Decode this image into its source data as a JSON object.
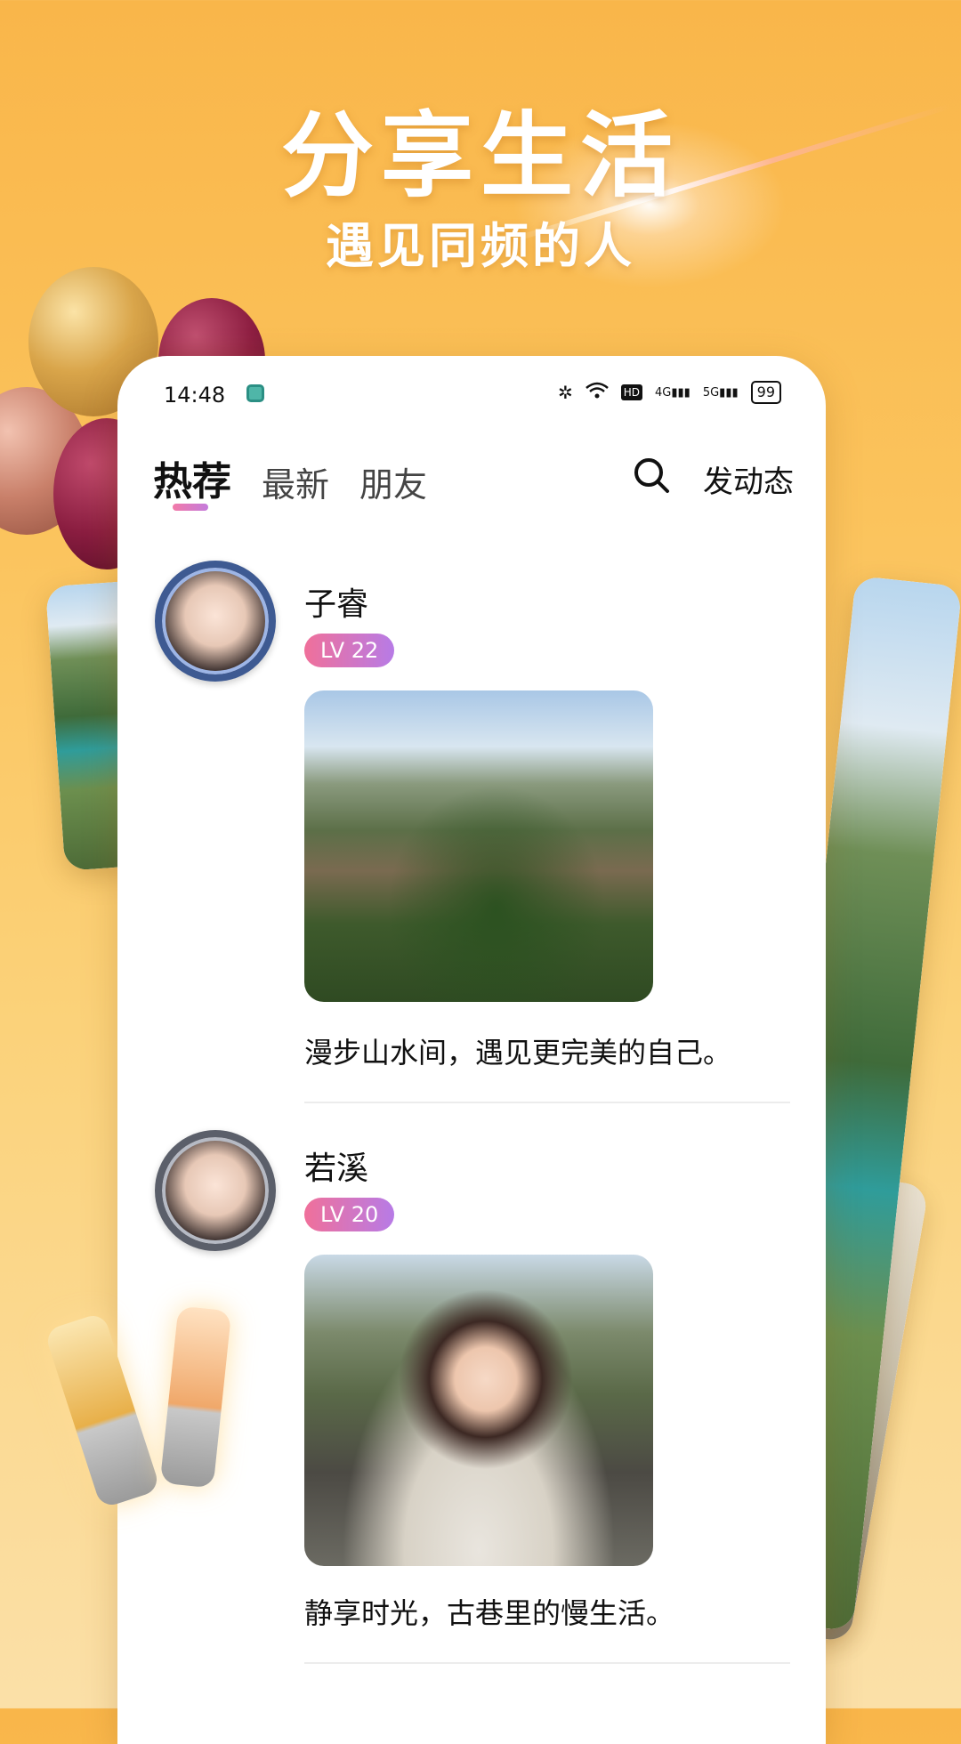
{
  "promo": {
    "title": "分享生活",
    "subtitle": "遇见同频的人"
  },
  "status_bar": {
    "time": "14:48",
    "icons": [
      "nfc-icon",
      "wifi-icon",
      "hd-icon",
      "signal-icon",
      "signal-icon"
    ],
    "signal_1": "4G",
    "signal_2": "5G",
    "battery": "99"
  },
  "tabs": [
    {
      "label": "热荐",
      "active": true
    },
    {
      "label": "最新",
      "active": false
    },
    {
      "label": "朋友",
      "active": false
    }
  ],
  "header": {
    "search_icon": "search-icon",
    "post_label": "发动态"
  },
  "posts": [
    {
      "username": "子睿",
      "level": "LV 22",
      "photo": "mountain-landscape",
      "caption": "漫步山水间，遇见更完美的自己。"
    },
    {
      "username": "若溪",
      "level": "LV 20",
      "photo": "woman-in-old-alley",
      "caption": "静享时光，古巷里的慢生活。"
    }
  ],
  "colors": {
    "background_top": "#f9b64a",
    "level_badge_start": "#f0709a",
    "level_badge_end": "#b77be6",
    "tab_indicator": "#f27aa8"
  }
}
